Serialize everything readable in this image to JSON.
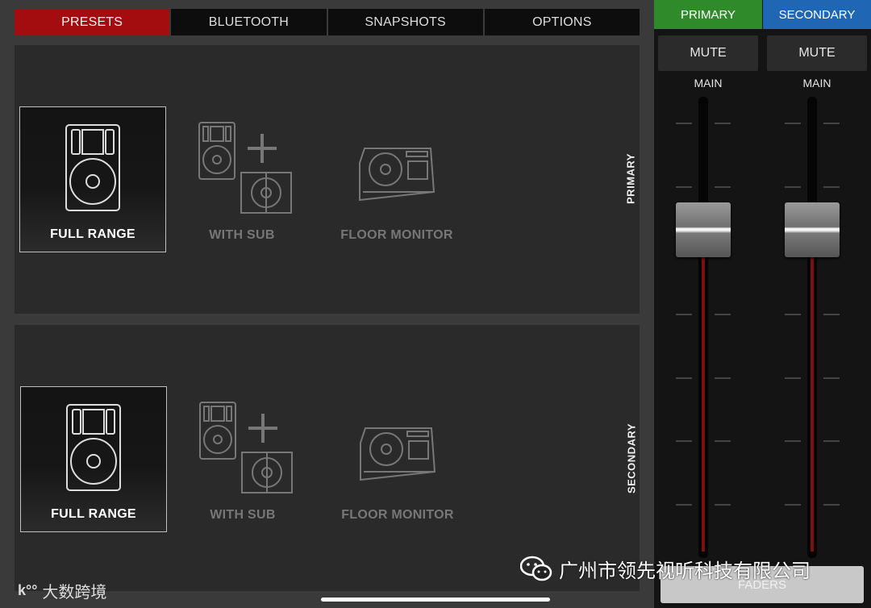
{
  "tabs": [
    {
      "label": "PRESETS",
      "active": true
    },
    {
      "label": "BLUETOOTH",
      "active": false
    },
    {
      "label": "SNAPSHOTS",
      "active": false
    },
    {
      "label": "OPTIONS",
      "active": false
    }
  ],
  "panels": {
    "primary": {
      "side_label": "PRIMARY",
      "presets": [
        {
          "label": "FULL RANGE",
          "selected": true
        },
        {
          "label": "WITH SUB",
          "selected": false
        },
        {
          "label": "FLOOR MONITOR",
          "selected": false
        }
      ]
    },
    "secondary": {
      "side_label": "SECONDARY",
      "presets": [
        {
          "label": "FULL RANGE",
          "selected": true
        },
        {
          "label": "WITH SUB",
          "selected": false
        },
        {
          "label": "FLOOR MONITOR",
          "selected": false
        }
      ]
    }
  },
  "mixer": {
    "primary_tab": "PRIMARY",
    "secondary_tab": "SECONDARY",
    "channels": [
      {
        "mute_label": "MUTE",
        "label": "MAIN",
        "level": 0.74
      },
      {
        "mute_label": "MUTE",
        "label": "MAIN",
        "level": 0.74
      }
    ],
    "faders_label": "FADERS"
  },
  "watermark": {
    "company": "广州市领先视听科技有限公司",
    "brand": "大数跨境"
  },
  "colors": {
    "presets_tab": "#a30d10",
    "primary_tab": "#2f8a2a",
    "secondary_tab": "#1f67b5",
    "fader_fill": "#7a1010"
  }
}
